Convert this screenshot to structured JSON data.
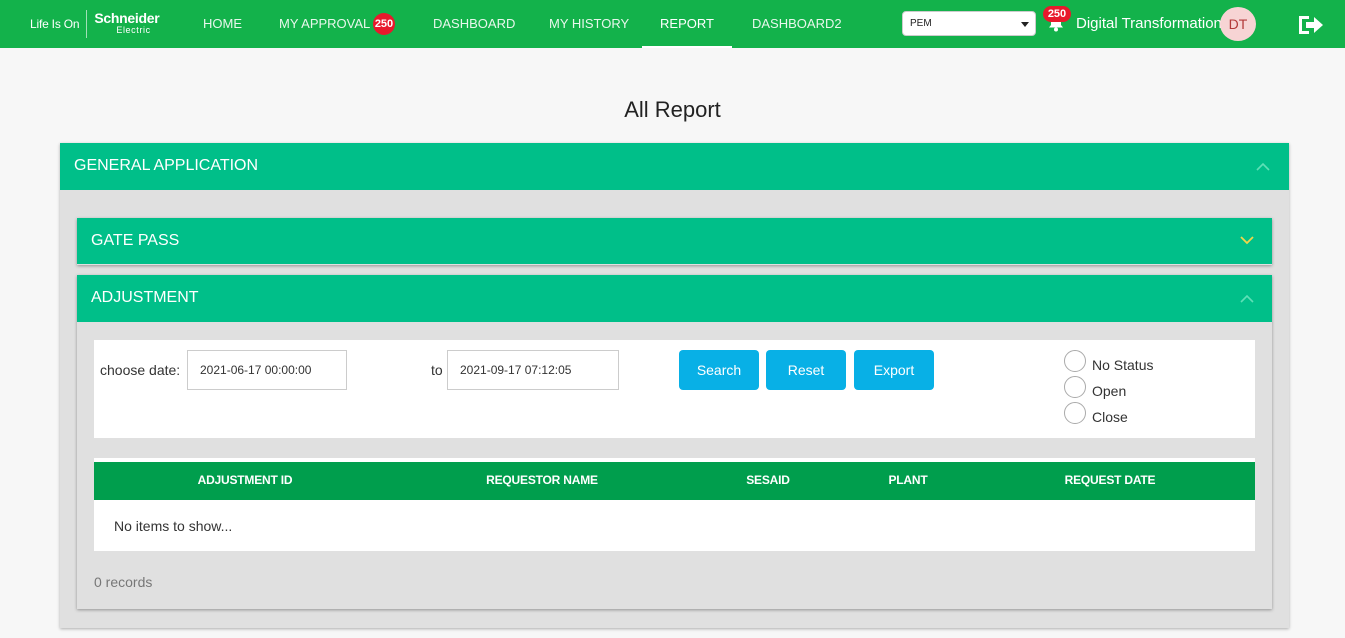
{
  "header": {
    "logo_tagline": "Life Is On",
    "logo_brand": "Schneider",
    "logo_sub": "Electric",
    "nav": [
      {
        "label": "HOME"
      },
      {
        "label": "MY APPROVAL",
        "badge": "250"
      },
      {
        "label": "DASHBOARD"
      },
      {
        "label": "MY HISTORY"
      },
      {
        "label": "REPORT",
        "active": true
      },
      {
        "label": "DASHBOARD2"
      }
    ],
    "plant_select": {
      "value": "PEM"
    },
    "notification_count": "250",
    "user_name": "Digital Transformation",
    "avatar_initials": "DT"
  },
  "page_title": "All Report",
  "sections": {
    "general": {
      "title": "GENERAL APPLICATION",
      "expanded": true
    },
    "gate_pass": {
      "title": "GATE PASS",
      "expanded": false
    },
    "adjustment": {
      "title": "ADJUSTMENT",
      "expanded": true
    }
  },
  "filter": {
    "choose_date_label": "choose date:",
    "from_value": "2021-06-17 00:00:00",
    "to_label": "to",
    "to_value": "2021-09-17 07:12:05",
    "buttons": {
      "search": "Search",
      "reset": "Reset",
      "export": "Export"
    },
    "status_options": [
      "No Status",
      "Open",
      "Close"
    ]
  },
  "table": {
    "columns": [
      "ADJUSTMENT ID",
      "REQUESTOR NAME",
      "SESAID",
      "PLANT",
      "REQUEST DATE"
    ],
    "empty_text": "No items to show...",
    "records_text": "0 records"
  },
  "colors": {
    "topbar": "#13b24b",
    "section_header": "#00bf89",
    "table_header": "#009e4d",
    "button": "#08b0e6",
    "badge": "#e8192c"
  }
}
